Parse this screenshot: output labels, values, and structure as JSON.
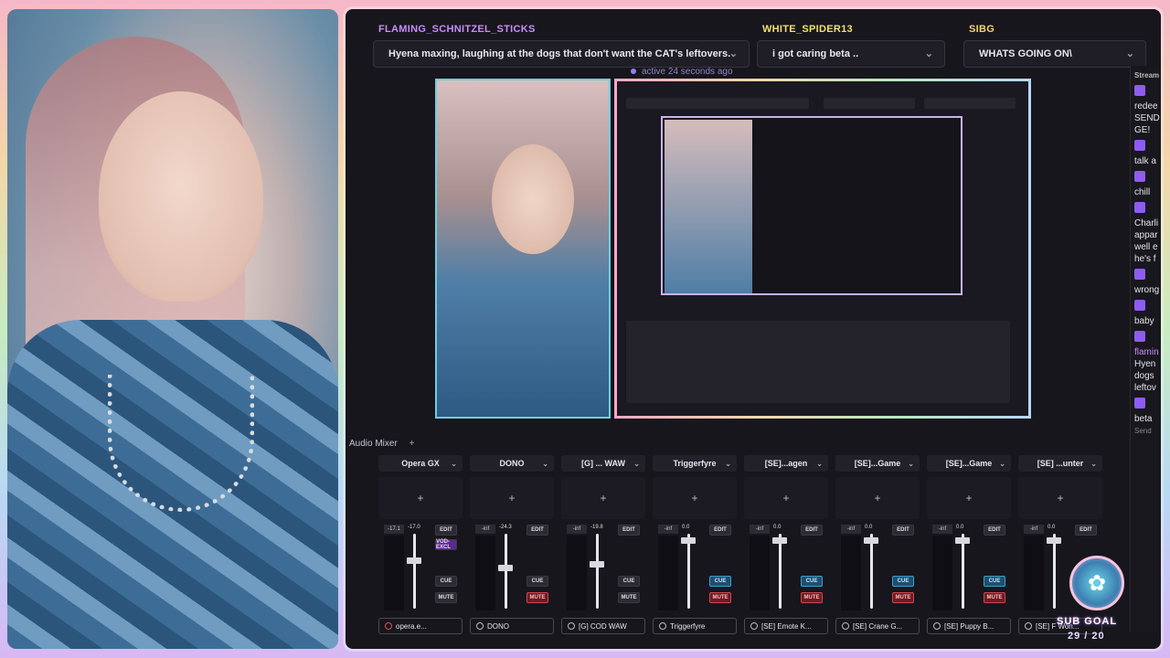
{
  "alerts": [
    {
      "name": "FLAMING_SCHNITZEL_STICKS",
      "message": "Hyena maxing, laughing at the dogs that don't want the CAT's leftovers.",
      "color": "#c88cff"
    },
    {
      "name": "WHITE_SPIDER13",
      "message": "i got caring beta ..",
      "color": "#f1e26b"
    },
    {
      "name": "SIBG",
      "message": "WHATS GOING ON\\",
      "color": "#f6d278"
    }
  ],
  "active_note": "active 24 seconds ago",
  "mixer": {
    "title": "Audio Mixer",
    "channels": [
      {
        "name": "Opera GX",
        "meter": "-17.1",
        "fader": "-17.0",
        "source": "opera.e...",
        "cue_on": false,
        "mute_on": false,
        "extra": "VOD-EXCL"
      },
      {
        "name": "DONO",
        "meter": "-inf",
        "fader": "-24.3",
        "source": "DONO",
        "cue_on": false,
        "mute_on": true
      },
      {
        "name": "[G] ... WAW",
        "meter": "-inf",
        "fader": "-19.8",
        "source": "[G] COD WAW",
        "cue_on": false,
        "mute_on": false
      },
      {
        "name": "Triggerfyre",
        "meter": "-inf",
        "fader": "0.0",
        "source": "Triggerfyre",
        "cue_on": true,
        "mute_on": true
      },
      {
        "name": "[SE]...agen",
        "meter": "-inf",
        "fader": "0.0",
        "source": "[SE] Emote K...",
        "cue_on": true,
        "mute_on": true
      },
      {
        "name": "[SE]...Game",
        "meter": "-inf",
        "fader": "0.0",
        "source": "[SE] Crane G...",
        "cue_on": true,
        "mute_on": true
      },
      {
        "name": "[SE]...Game",
        "meter": "-inf",
        "fader": "0.0",
        "source": "[SE] Puppy B...",
        "cue_on": true,
        "mute_on": true
      },
      {
        "name": "[SE] ...unter",
        "meter": "-inf",
        "fader": "0.0",
        "source": "[SE] F Won...",
        "cue_on": false,
        "mute_on": false
      }
    ],
    "edit_label": "EDIT",
    "cue_label": "CUE",
    "mute_label": "MUTE",
    "add_symbol": "+"
  },
  "chat": {
    "header": "Stream",
    "lines": [
      "redee",
      "SEND",
      "GE!",
      "talk a",
      "chill",
      "Charli",
      "appar",
      "well e",
      "he's f",
      "wrong",
      "baby",
      "flamin",
      "Hyen",
      "dogs",
      "leftov",
      "beta",
      "Send"
    ]
  },
  "sub_goal": {
    "label": "SUB GOAL",
    "count": "29 / 20"
  },
  "colors": {
    "accent": "#8e5cf0",
    "cue": "#3aa0d0",
    "mute": "#d0454e"
  }
}
